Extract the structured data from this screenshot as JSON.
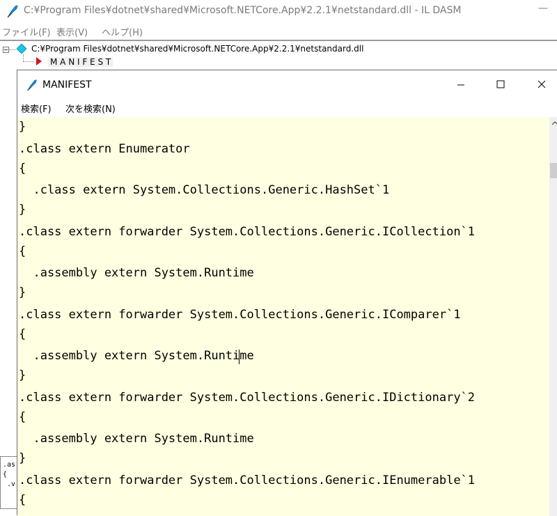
{
  "main_window": {
    "title": "C:¥Program Files¥dotnet¥shared¥Microsoft.NETCore.App¥2.2.1¥netstandard.dll - IL DASM",
    "minimize_glyph": "—",
    "menu": [
      {
        "label": "ファイル(F)"
      },
      {
        "label": "表示(V)"
      },
      {
        "label": "ヘルプ(H)"
      }
    ]
  },
  "tree": {
    "root_label": "C:¥Program Files¥dotnet¥shared¥Microsoft.NETCore.App¥2.2.1¥netstandard.dll",
    "child_label": "M A N I F E S T",
    "root_icon": "diamond-icon",
    "child_icon": "red-triangle-icon"
  },
  "manifest_window": {
    "title": "MANIFEST",
    "menu": [
      {
        "label": "検索(F)"
      },
      {
        "label": "次を検索(N)"
      }
    ],
    "buttons": [
      "minimize-icon",
      "maximize-icon",
      "close-icon"
    ],
    "background_color": "#ffffe1",
    "code_lines": [
      "}",
      ".class extern Enumerator",
      "{",
      "  .class extern System.Collections.Generic.HashSet`1",
      "}",
      ".class extern forwarder System.Collections.Generic.ICollection`1",
      "{",
      "  .assembly extern System.Runtime",
      "}",
      ".class extern forwarder System.Collections.Generic.IComparer`1",
      "{",
      "  .assembly extern System.Runtime",
      "}",
      ".class extern forwarder System.Collections.Generic.IDictionary`2",
      "{",
      "  .assembly extern System.Runtime",
      "}",
      ".class extern forwarder System.Collections.Generic.IEnumerable`1",
      "{"
    ]
  },
  "background_window": {
    "lines": [
      ".as",
      "{",
      " .v"
    ]
  }
}
